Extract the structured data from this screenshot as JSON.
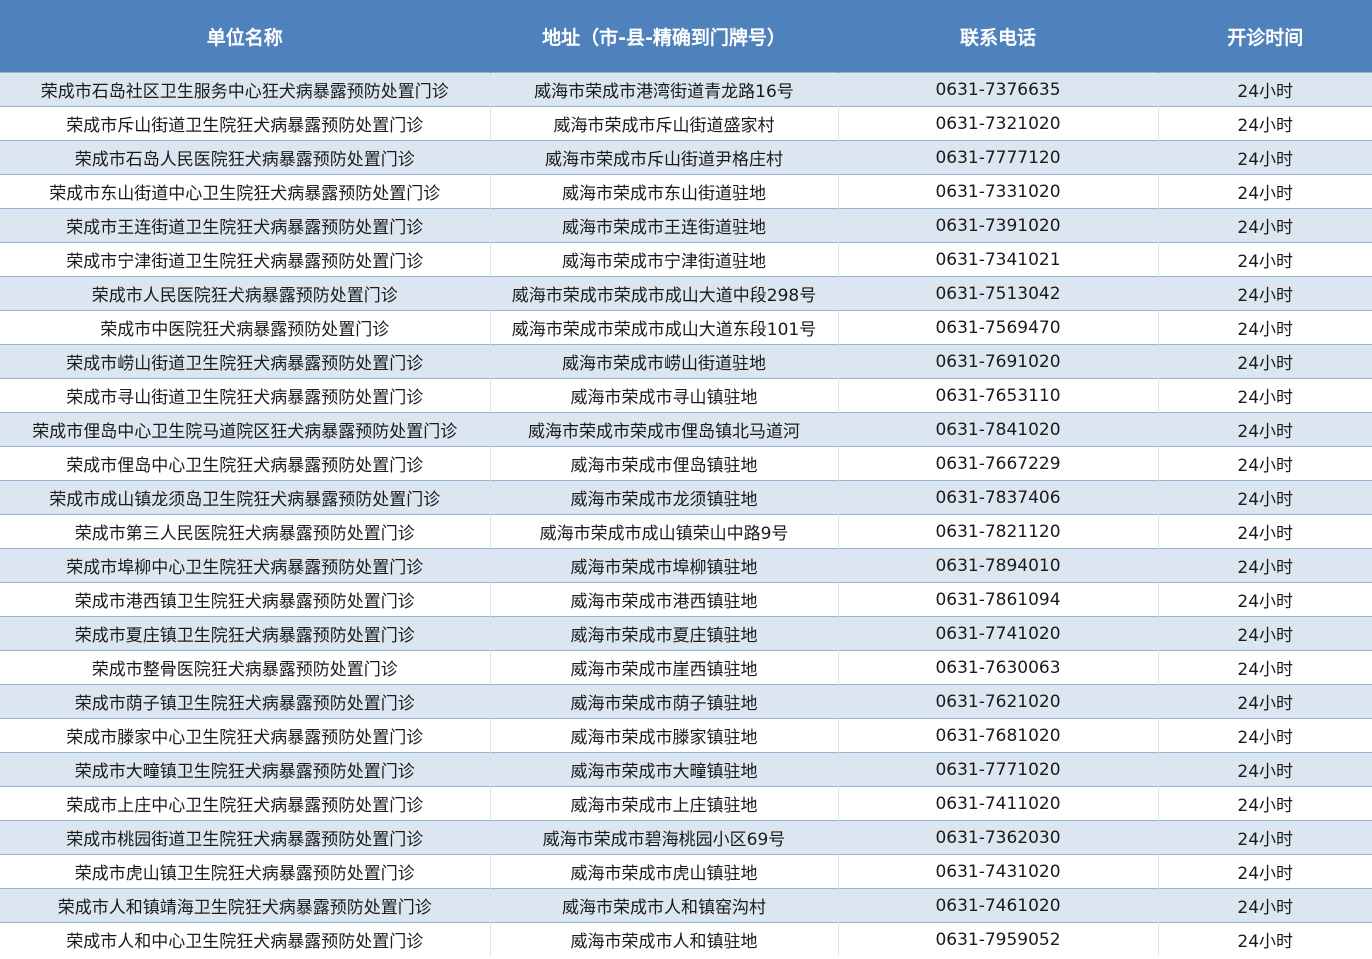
{
  "table": {
    "headers": [
      "单位名称",
      "地址（市-县-精确到门牌号）",
      "联系电话",
      "开诊时间"
    ],
    "rows": [
      [
        "荣成市石岛社区卫生服务中心狂犬病暴露预防处置门诊",
        "威海市荣成市港湾街道青龙路16号",
        "0631-7376635",
        "24小时"
      ],
      [
        "荣成市斥山街道卫生院狂犬病暴露预防处置门诊",
        "威海市荣成市斥山街道盛家村",
        "0631-7321020",
        "24小时"
      ],
      [
        "荣成市石岛人民医院狂犬病暴露预防处置门诊",
        "威海市荣成市斥山街道尹格庄村",
        "0631-7777120",
        "24小时"
      ],
      [
        "荣成市东山街道中心卫生院狂犬病暴露预防处置门诊",
        "威海市荣成市东山街道驻地",
        "0631-7331020",
        "24小时"
      ],
      [
        "荣成市王连街道卫生院狂犬病暴露预防处置门诊",
        "威海市荣成市王连街道驻地",
        "0631-7391020",
        "24小时"
      ],
      [
        "荣成市宁津街道卫生院狂犬病暴露预防处置门诊",
        "威海市荣成市宁津街道驻地",
        "0631-7341021",
        "24小时"
      ],
      [
        "荣成市人民医院狂犬病暴露预防处置门诊",
        "威海市荣成市荣成市成山大道中段298号",
        "0631-7513042",
        "24小时"
      ],
      [
        "荣成市中医院狂犬病暴露预防处置门诊",
        "威海市荣成市荣成市成山大道东段101号",
        "0631-7569470",
        "24小时"
      ],
      [
        "荣成市崂山街道卫生院狂犬病暴露预防处置门诊",
        "威海市荣成市崂山街道驻地",
        "0631-7691020",
        "24小时"
      ],
      [
        "荣成市寻山街道卫生院狂犬病暴露预防处置门诊",
        "威海市荣成市寻山镇驻地",
        "0631-7653110",
        "24小时"
      ],
      [
        "荣成市俚岛中心卫生院马道院区狂犬病暴露预防处置门诊",
        "威海市荣成市荣成市俚岛镇北马道河",
        "0631-7841020",
        "24小时"
      ],
      [
        "荣成市俚岛中心卫生院狂犬病暴露预防处置门诊",
        "威海市荣成市俚岛镇驻地",
        "0631-7667229",
        "24小时"
      ],
      [
        "荣成市成山镇龙须岛卫生院狂犬病暴露预防处置门诊",
        "威海市荣成市龙须镇驻地",
        "0631-7837406",
        "24小时"
      ],
      [
        "荣成市第三人民医院狂犬病暴露预防处置门诊",
        "威海市荣成市成山镇荣山中路9号",
        "0631-7821120",
        "24小时"
      ],
      [
        "荣成市埠柳中心卫生院狂犬病暴露预防处置门诊",
        "威海市荣成市埠柳镇驻地",
        "0631-7894010",
        "24小时"
      ],
      [
        "荣成市港西镇卫生院狂犬病暴露预防处置门诊",
        "威海市荣成市港西镇驻地",
        "0631-7861094",
        "24小时"
      ],
      [
        "荣成市夏庄镇卫生院狂犬病暴露预防处置门诊",
        "威海市荣成市夏庄镇驻地",
        "0631-7741020",
        "24小时"
      ],
      [
        "荣成市整骨医院狂犬病暴露预防处置门诊",
        "威海市荣成市崖西镇驻地",
        "0631-7630063",
        "24小时"
      ],
      [
        "荣成市荫子镇卫生院狂犬病暴露预防处置门诊",
        "威海市荣成市荫子镇驻地",
        "0631-7621020",
        "24小时"
      ],
      [
        "荣成市滕家中心卫生院狂犬病暴露预防处置门诊",
        "威海市荣成市滕家镇驻地",
        "0631-7681020",
        "24小时"
      ],
      [
        "荣成市大疃镇卫生院狂犬病暴露预防处置门诊",
        "威海市荣成市大疃镇驻地",
        "0631-7771020",
        "24小时"
      ],
      [
        "荣成市上庄中心卫生院狂犬病暴露预防处置门诊",
        "威海市荣成市上庄镇驻地",
        "0631-7411020",
        "24小时"
      ],
      [
        "荣成市桃园街道卫生院狂犬病暴露预防处置门诊",
        "威海市荣成市碧海桃园小区69号",
        "0631-7362030",
        "24小时"
      ],
      [
        "荣成市虎山镇卫生院狂犬病暴露预防处置门诊",
        "威海市荣成市虎山镇驻地",
        "0631-7431020",
        "24小时"
      ],
      [
        "荣成市人和镇靖海卫生院狂犬病暴露预防处置门诊",
        "威海市荣成市人和镇窑沟村",
        "0631-7461020",
        "24小时"
      ],
      [
        "荣成市人和中心卫生院狂犬病暴露预防处置门诊",
        "威海市荣成市人和镇驻地",
        "0631-7959052",
        "24小时"
      ]
    ]
  }
}
